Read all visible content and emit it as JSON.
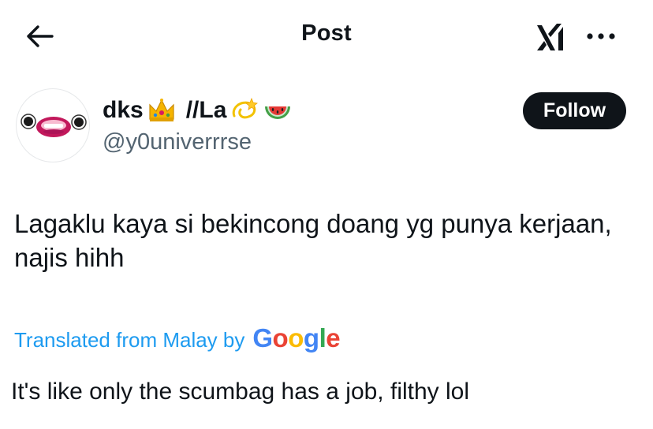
{
  "header": {
    "title": "Post",
    "back_icon": "arrow-left-icon",
    "grok_icon": "grok-icon",
    "more_icon": "more-horizontal-icon"
  },
  "author": {
    "name_part1": "dks",
    "name_part2": "//La",
    "emojis": [
      "crown-emoji",
      "dizzy-emoji",
      "watermelon-emoji"
    ],
    "handle": "@y0univerrrse",
    "avatar": "cartoon-face-avatar"
  },
  "follow_button": {
    "label": "Follow"
  },
  "tweet": {
    "text": "Lagaklu kaya si bekincong doang yg punya kerjaan, najis hihh"
  },
  "translation": {
    "label": "Translated from Malay by",
    "provider_letters": [
      "G",
      "o",
      "o",
      "g",
      "l",
      "e"
    ],
    "text": "It's like only the scumbag has a job, filthy lol"
  },
  "colors": {
    "text_primary": "#0f1419",
    "text_secondary": "#536471",
    "link_blue": "#1d9bf0",
    "button_dark": "#0f1419"
  }
}
